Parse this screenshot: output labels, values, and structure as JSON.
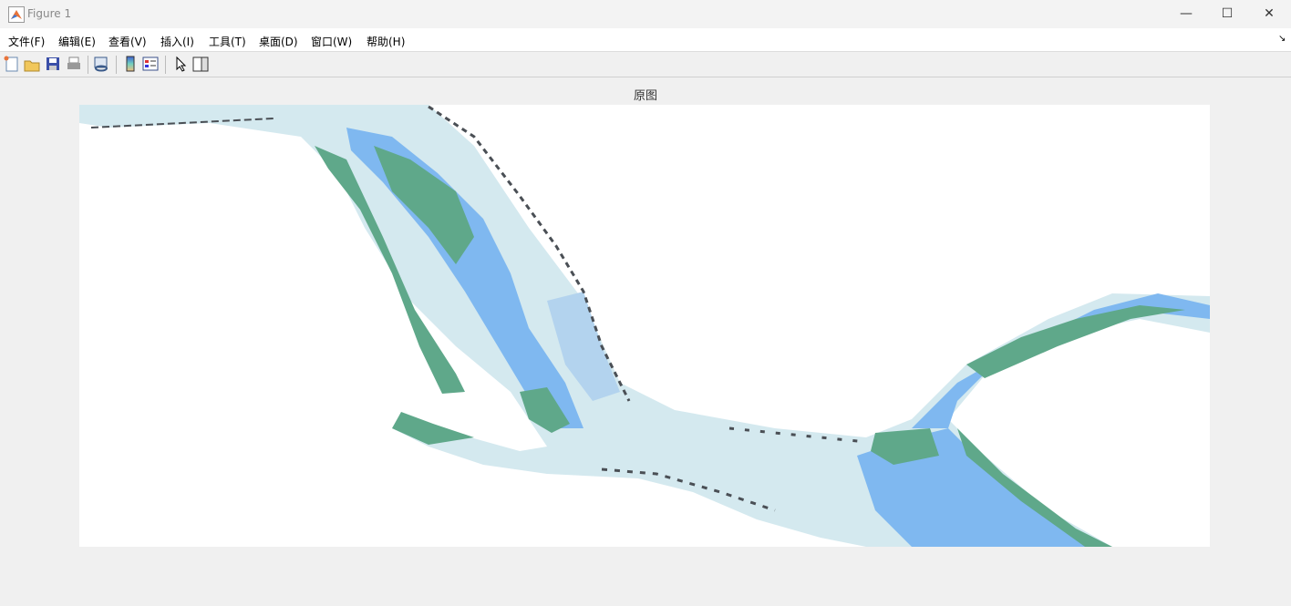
{
  "window": {
    "title": "Figure 1",
    "minimize": "—",
    "maximize": "☐",
    "close": "✕"
  },
  "menu": [
    "文件(F)",
    "编辑(E)",
    "查看(V)",
    "插入(I)",
    "工具(T)",
    "桌面(D)",
    "窗口(W)",
    "帮助(H)"
  ],
  "menu_arrow": "↘",
  "toolbar": [
    "new-figure-icon",
    "open-file-icon",
    "save-icon",
    "print-icon",
    "link-plot-icon",
    "colorbar-icon",
    "legend-icon",
    "pointer-icon",
    "property-inspector-icon"
  ],
  "axes": {
    "title": "原图"
  },
  "colors": {
    "water_light": "#d4e9ef",
    "water_mid": "#b3d3ee",
    "water_blue": "#7fb8f0",
    "shoal_green": "#5fa88a",
    "structure": "#4a4f55"
  }
}
